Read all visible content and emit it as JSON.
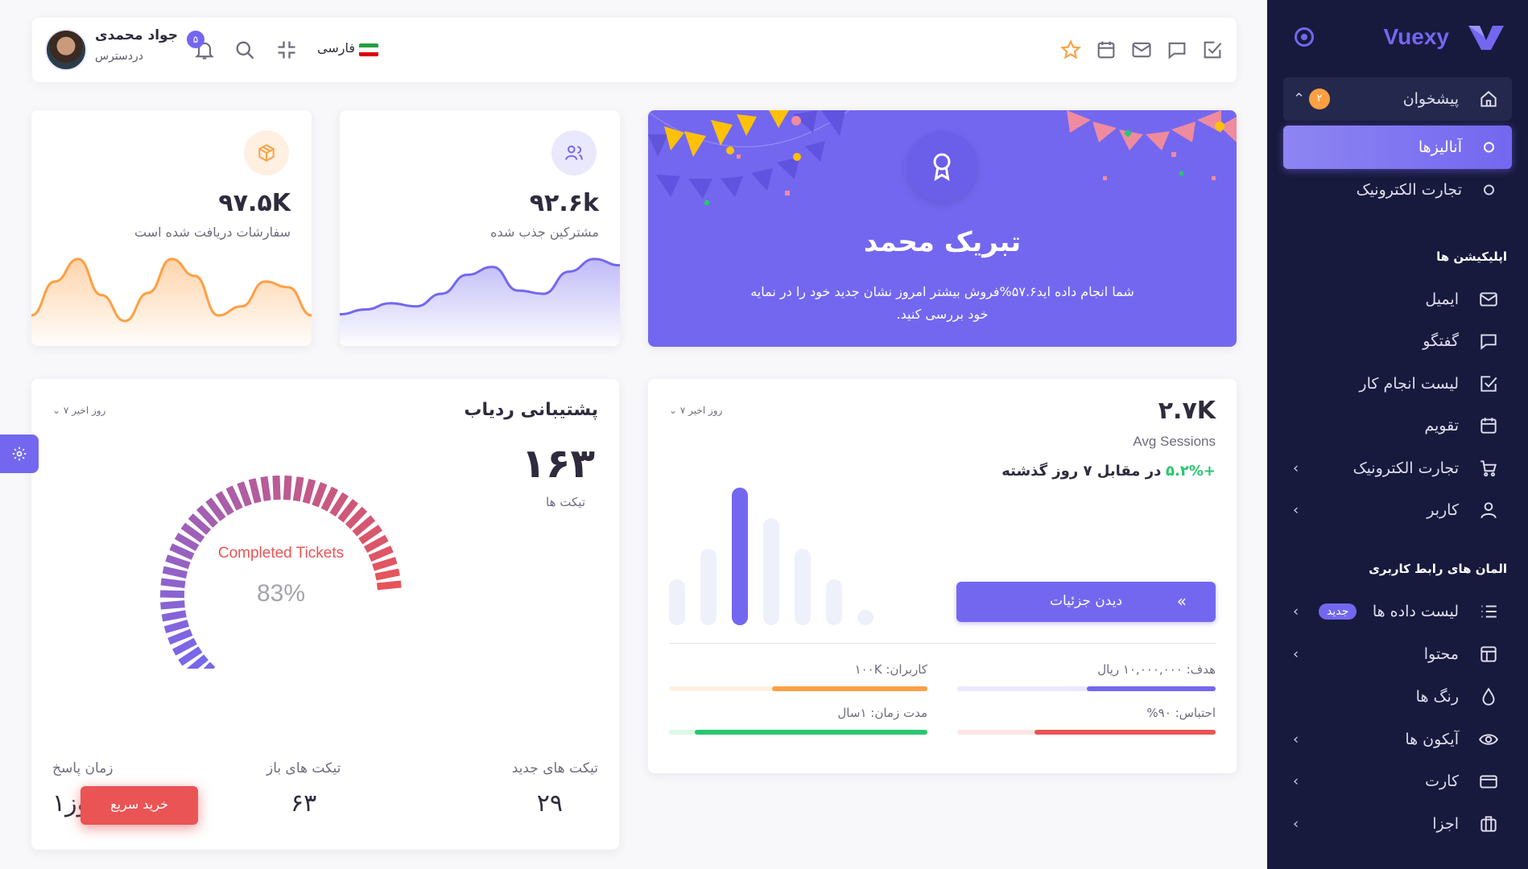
{
  "sidebar": {
    "brand": "Vuexy",
    "dashboard": {
      "label": "پیشخوان",
      "badge": "۲"
    },
    "dashboard_children": [
      {
        "label": "آنالیزها"
      },
      {
        "label": "تجارت الکترونیک"
      }
    ],
    "apps_header": "اپلیکیشن ها",
    "apps": [
      {
        "label": "ایمیل",
        "icon": "mail-icon"
      },
      {
        "label": "گفتگو",
        "icon": "chat-icon"
      },
      {
        "label": "لیست انجام کار",
        "icon": "checkbox-icon"
      },
      {
        "label": "تقویم",
        "icon": "calendar-icon"
      },
      {
        "label": "تجارت الکترونیک",
        "icon": "cart-icon"
      },
      {
        "label": "کاربر",
        "icon": "user-icon"
      }
    ],
    "ui_header": "المان های رابط کاربری",
    "ui": [
      {
        "label": "لیست داده ها",
        "icon": "list-icon",
        "badge": "جدید"
      },
      {
        "label": "محتوا",
        "icon": "layout-icon"
      },
      {
        "label": "رنگ ها",
        "icon": "droplet-icon"
      },
      {
        "label": "آیکون ها",
        "icon": "eye-icon"
      },
      {
        "label": "کارت",
        "icon": "credit-card-icon"
      },
      {
        "label": "اجزا",
        "icon": "box-icon"
      }
    ]
  },
  "topbar": {
    "user_name": "جواد محمدی",
    "user_status": "دردسترس",
    "notification_count": "۵",
    "language": "فارسی"
  },
  "congrats": {
    "title": "تبریک محمد",
    "line1": "شما انجام داده اید۵۷.۶%فروش بیشتر امروز نشان جدید خود را در نمایه",
    "line2": "خود بررسی کنید."
  },
  "subscribers": {
    "value": "۹۲.۶k",
    "label": "مشترکین جذب شده",
    "chart": [
      15,
      18,
      22,
      20,
      28,
      40,
      45,
      30,
      28,
      42,
      50,
      46
    ]
  },
  "orders": {
    "value": "۹۷.۵K",
    "label": "سفارشات دریافت شده است",
    "chart": [
      20,
      50,
      70,
      38,
      15,
      40,
      70,
      55,
      20,
      28,
      50,
      45,
      20
    ]
  },
  "sessions": {
    "value": "۲.۷K",
    "label": "Avg Sessions",
    "change": "+۵.۲%",
    "change_text": "در مقابل ۷ روز گذشته",
    "period": "۷ روز اخیر",
    "button": "دیدن جزئیات",
    "chart_data": {
      "type": "bar",
      "values": [
        30,
        50,
        90,
        70,
        50,
        30,
        10
      ],
      "highlight_index": 2
    },
    "goals": [
      {
        "label": "هدف: ۱۰,۰۰۰,۰۰۰ ریال",
        "percent": 50,
        "color": "#7367f0",
        "track": "#eae8fd"
      },
      {
        "label": "کاربران: ۱۰۰K",
        "percent": 60,
        "color": "#ff9f43",
        "track": "#fff0e1"
      },
      {
        "label": "احتباس: ۹۰%",
        "percent": 70,
        "color": "#ea5455",
        "track": "#fce5e6"
      },
      {
        "label": "مدت زمان: ۱سال",
        "percent": 90,
        "color": "#28c76f",
        "track": "#dff7e9"
      }
    ]
  },
  "support": {
    "title": "پشتیبانی ردیاب",
    "period": "۷ روز اخیر",
    "total": "۱۶۳",
    "total_label": "تیکت ها",
    "gauge_label": "Completed Tickets",
    "gauge_value": "83%",
    "gauge_percent": 83,
    "stats": [
      {
        "label": "تیکت های جدید",
        "value": "۲۹"
      },
      {
        "label": "تیکت های باز",
        "value": "۶۳"
      },
      {
        "label": "زمان پاسخ",
        "value": "۱روز"
      }
    ]
  },
  "buy_button": "خرید سریع",
  "colors": {
    "primary": "#7367f0",
    "sidebar": "#171a3d",
    "orange": "#ff9f43",
    "red": "#ea5455",
    "green": "#28c76f"
  }
}
